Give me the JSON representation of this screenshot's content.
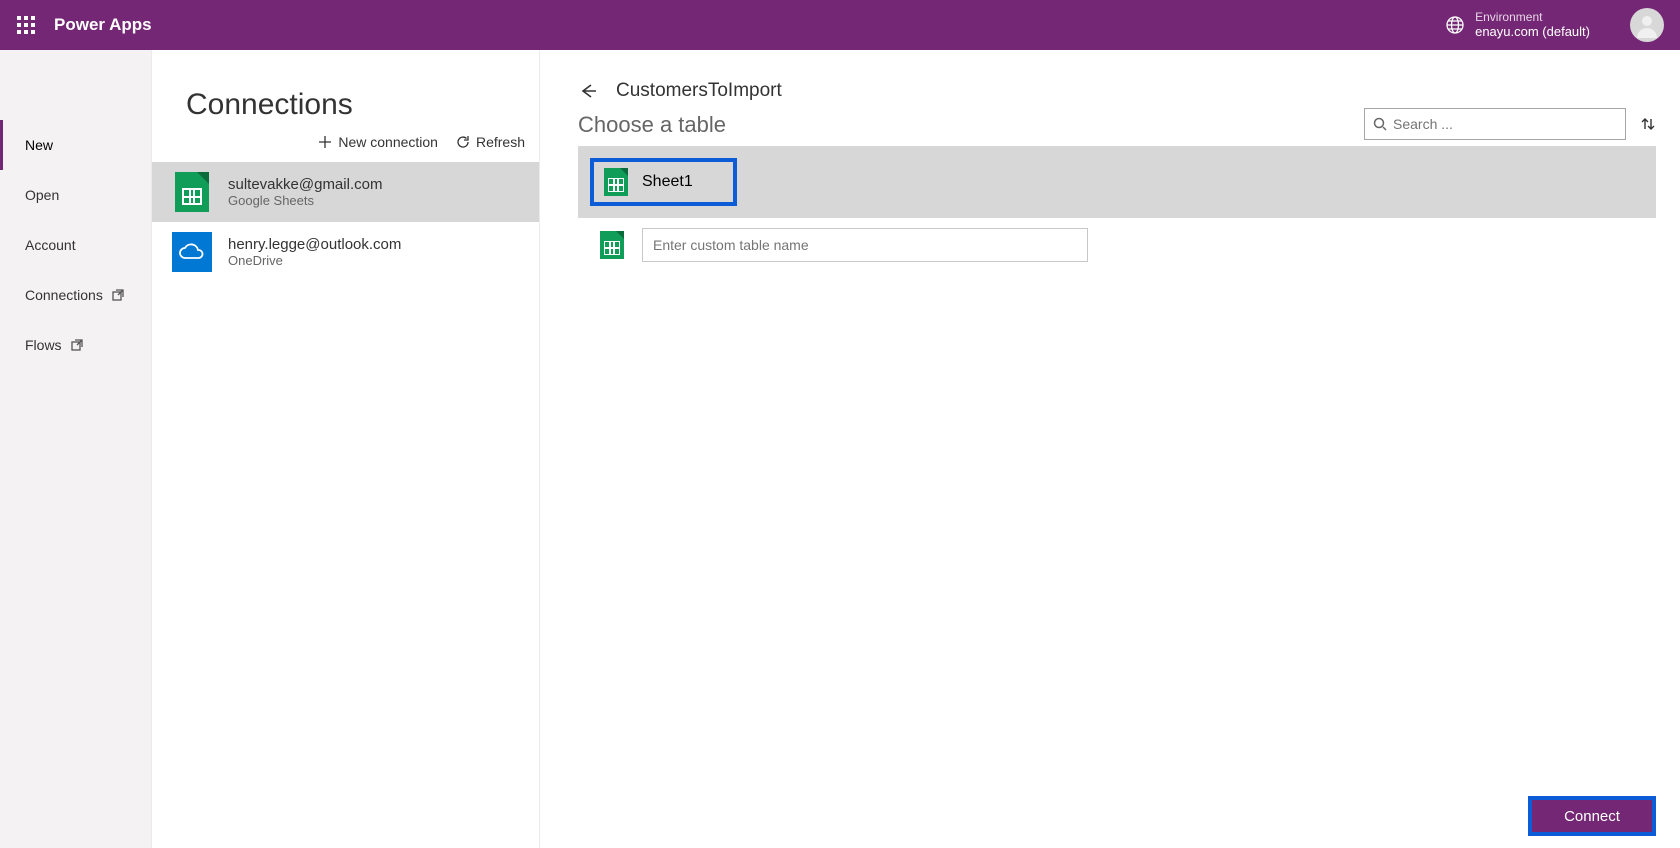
{
  "header": {
    "brand": "Power Apps",
    "env_label": "Environment",
    "env_value": "enayu.com (default)"
  },
  "sidebar": {
    "items": [
      {
        "label": "New",
        "active": true,
        "external": false
      },
      {
        "label": "Open",
        "active": false,
        "external": false
      },
      {
        "label": "Account",
        "active": false,
        "external": false
      },
      {
        "label": "Connections",
        "active": false,
        "external": true
      },
      {
        "label": "Flows",
        "active": false,
        "external": true
      }
    ]
  },
  "connections": {
    "title": "Connections",
    "toolbar": {
      "new_label": "New connection",
      "refresh_label": "Refresh"
    },
    "items": [
      {
        "title": "sultevakke@gmail.com",
        "subtitle": "Google Sheets",
        "icon": "gsheets",
        "selected": true
      },
      {
        "title": "henry.legge@outlook.com",
        "subtitle": "OneDrive",
        "icon": "onedrive",
        "selected": false
      }
    ]
  },
  "main": {
    "breadcrumb": "CustomersToImport",
    "subtitle": "Choose a table",
    "search_placeholder": "Search ...",
    "tables": [
      {
        "label": "Sheet1",
        "selected": true
      }
    ],
    "custom_placeholder": "Enter custom table name",
    "connect_label": "Connect"
  }
}
